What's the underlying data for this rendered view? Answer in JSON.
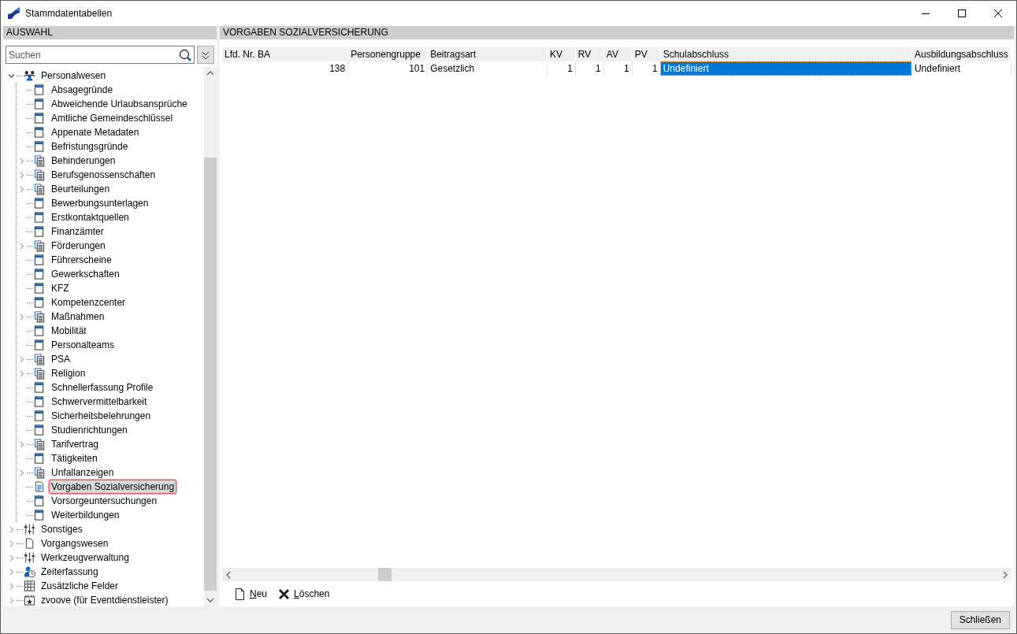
{
  "window": {
    "title": "Stammdatentabellen"
  },
  "sidebar": {
    "header": "AUSWAHL",
    "search": {
      "placeholder": "Suchen"
    },
    "tree": [
      {
        "label": "Personalwesen",
        "kind": "people",
        "expanded": true,
        "children": [
          {
            "label": "Absagegründe",
            "kind": "table",
            "selected": false
          },
          {
            "label": "Abweichende Urlaubsansprüche",
            "kind": "table",
            "selected": false
          },
          {
            "label": "Amtliche Gemeindeschlüssel",
            "kind": "table",
            "selected": false
          },
          {
            "label": "Appenate Metadaten",
            "kind": "table",
            "selected": false
          },
          {
            "label": "Befristungsgründe",
            "kind": "table",
            "selected": false
          },
          {
            "label": "Behinderungen",
            "kind": "group",
            "selected": false
          },
          {
            "label": "Berufsgenossenschaften",
            "kind": "group",
            "selected": false
          },
          {
            "label": "Beurteilungen",
            "kind": "group",
            "selected": false
          },
          {
            "label": "Bewerbungsunterlagen",
            "kind": "table",
            "selected": false
          },
          {
            "label": "Erstkontaktquellen",
            "kind": "table",
            "selected": false
          },
          {
            "label": "Finanzämter",
            "kind": "table",
            "selected": false
          },
          {
            "label": "Förderungen",
            "kind": "group",
            "selected": false
          },
          {
            "label": "Führerscheine",
            "kind": "table",
            "selected": false
          },
          {
            "label": "Gewerkschaften",
            "kind": "table",
            "selected": false
          },
          {
            "label": "KFZ",
            "kind": "table",
            "selected": false
          },
          {
            "label": "Kompetenzcenter",
            "kind": "table",
            "selected": false
          },
          {
            "label": "Maßnahmen",
            "kind": "group",
            "selected": false
          },
          {
            "label": "Mobilität",
            "kind": "table",
            "selected": false
          },
          {
            "label": "Personalteams",
            "kind": "table",
            "selected": false
          },
          {
            "label": "PSA",
            "kind": "group",
            "selected": false
          },
          {
            "label": "Religion",
            "kind": "group",
            "selected": false
          },
          {
            "label": "Schnellerfassung Profile",
            "kind": "table",
            "selected": false
          },
          {
            "label": "Schwervermittelbarkeit",
            "kind": "table",
            "selected": false
          },
          {
            "label": "Sicherheitsbelehrungen",
            "kind": "table",
            "selected": false
          },
          {
            "label": "Studienrichtungen",
            "kind": "table",
            "selected": false
          },
          {
            "label": "Tarifvertrag",
            "kind": "group",
            "selected": false
          },
          {
            "label": "Tätigkeiten",
            "kind": "table",
            "selected": false
          },
          {
            "label": "Unfallanzeigen",
            "kind": "group",
            "selected": false
          },
          {
            "label": "Vorgaben Sozialversicherung",
            "kind": "document",
            "selected": true
          },
          {
            "label": "Vorsorgeuntersuchungen",
            "kind": "table",
            "selected": false
          },
          {
            "label": "Weiterbildungen",
            "kind": "table",
            "selected": false
          }
        ]
      },
      {
        "label": "Sonstiges",
        "kind": "sliders",
        "expanded": false
      },
      {
        "label": "Vorgangswesen",
        "kind": "page",
        "expanded": false
      },
      {
        "label": "Werkzeugverwaltung",
        "kind": "sliders",
        "expanded": false
      },
      {
        "label": "Zeiterfassung",
        "kind": "clock",
        "expanded": false
      },
      {
        "label": "Zusätzliche Felder",
        "kind": "grid",
        "expanded": false
      },
      {
        "label": "zvoove (für Eventdienstleister)",
        "kind": "calendar",
        "expanded": false
      }
    ]
  },
  "main": {
    "header": "VORGABEN SOZIALVERSICHERUNG",
    "table": {
      "columns": [
        {
          "label": "Lfd. Nr. BA",
          "kind": "number"
        },
        {
          "label": "Personengruppe",
          "kind": "number"
        },
        {
          "label": "Beitragsart",
          "kind": "text"
        },
        {
          "label": "KV",
          "kind": "number"
        },
        {
          "label": "RV",
          "kind": "number"
        },
        {
          "label": "AV",
          "kind": "number"
        },
        {
          "label": "PV",
          "kind": "number"
        },
        {
          "label": "Schulabschluss",
          "kind": "text"
        },
        {
          "label": "Ausbildungsabschluss",
          "kind": "text"
        }
      ],
      "rows": [
        {
          "cells": [
            {
              "text": "138",
              "selected": false
            },
            {
              "text": "101",
              "selected": false
            },
            {
              "text": "Gesetzlich",
              "selected": false
            },
            {
              "text": "1",
              "selected": false
            },
            {
              "text": "1",
              "selected": false
            },
            {
              "text": "1",
              "selected": false
            },
            {
              "text": "1",
              "selected": false
            },
            {
              "text": "Undefiniert",
              "selected": true
            },
            {
              "text": "Undefiniert",
              "selected": false
            }
          ]
        }
      ]
    },
    "toolbar": [
      {
        "label": "Neu",
        "kind": "new"
      },
      {
        "label": "Löschen",
        "kind": "delete"
      }
    ]
  },
  "footer": {
    "buttons": [
      "Schließen"
    ]
  }
}
